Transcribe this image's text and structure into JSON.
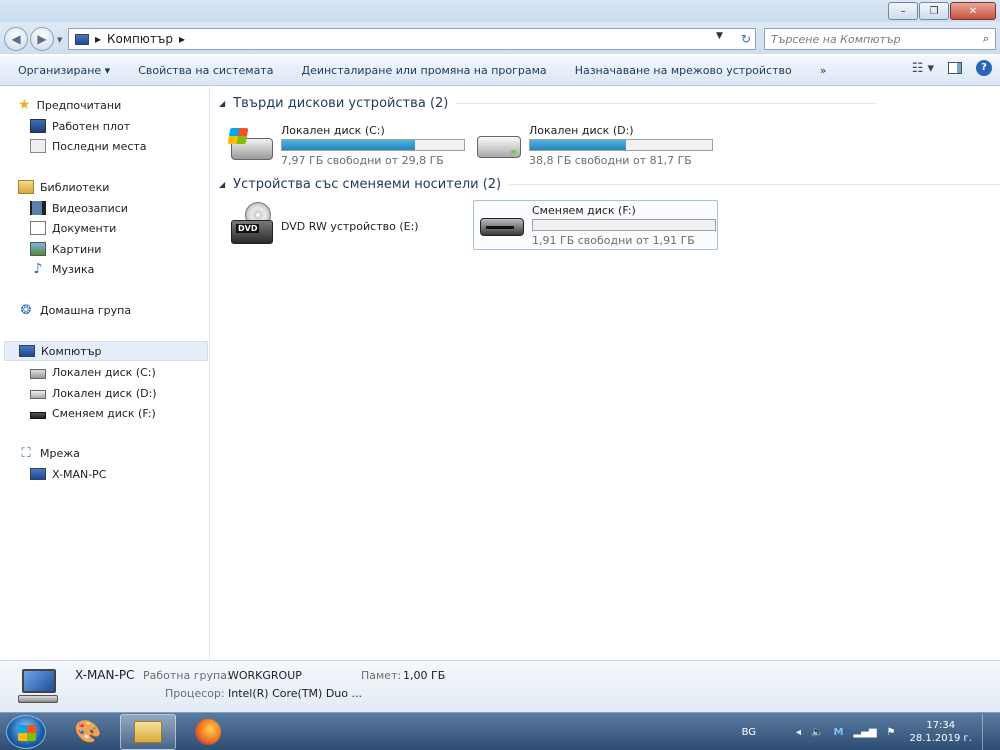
{
  "window": {
    "minimize_label": "–",
    "maximize_label": "❐",
    "close_label": "✕"
  },
  "address": {
    "breadcrumb": [
      "Компютър"
    ],
    "search_placeholder": "Търсене на Компютър"
  },
  "toolbar": {
    "items": [
      "Организиране ▾",
      "Свойства на системата",
      "Деинсталиране или промяна на програма",
      "Назначаване на мрежово устройство",
      "»"
    ]
  },
  "sidebar": {
    "favorites": {
      "label": "Предпочитани",
      "items": [
        "Работен плот",
        "Последни места"
      ]
    },
    "libraries": {
      "label": "Библиотеки",
      "items": [
        "Видеозаписи",
        "Документи",
        "Картини",
        "Музика"
      ]
    },
    "homegroup": {
      "label": "Домашна група"
    },
    "computer": {
      "label": "Компютър",
      "items": [
        "Локален диск (C:)",
        "Локален диск (D:)",
        "Сменяем диск (F:)"
      ]
    },
    "network": {
      "label": "Мрежа",
      "items": [
        "X-MAN-PC"
      ]
    }
  },
  "groups": {
    "hard_disks": {
      "label": "Твърди дискови устройства (2)"
    },
    "removable": {
      "label": "Устройства със сменяеми носители (2)"
    }
  },
  "drives": [
    {
      "name": "Локален диск (C:)",
      "free": "7,97 ГБ свободни от 29,8 ГБ",
      "used_fraction": 0.73
    },
    {
      "name": "Локален диск (D:)",
      "free": "38,8 ГБ свободни от 81,7 ГБ",
      "used_fraction": 0.53
    },
    {
      "name": "DVD RW устройство (E:)"
    },
    {
      "name": "Сменяем диск (F:)",
      "free": "1,91 ГБ свободни от 1,91 ГБ",
      "used_fraction": 0.0
    }
  ],
  "details": {
    "computer_name": "X-MAN-PC",
    "workgroup_label": "Работна група:",
    "workgroup_value": "WORKGROUP",
    "memory_label": "Памет:",
    "memory_value": "1,00 ГБ",
    "processor_label": "Процесор:",
    "processor_value": "Intel(R) Core(TM) Duo ..."
  },
  "taskbar": {
    "language": "BG",
    "time": "17:34",
    "date": "28.1.2019 г."
  },
  "colors": {
    "accent": "#2687bd",
    "title_bar": "#dbe7f5",
    "taskbar": "#2d4d74"
  }
}
